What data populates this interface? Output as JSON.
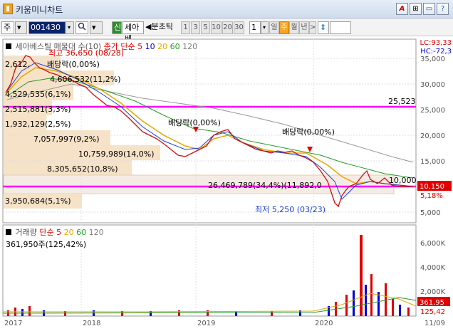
{
  "window": {
    "title": "키움미니차트",
    "app_icon": "chart-app-icon"
  },
  "titlebar_buttons": [
    "A",
    "⊞",
    "▭",
    "?",
    "✕"
  ],
  "toolbar": {
    "market": "주",
    "code": "001430",
    "search_icon": "search-icon",
    "new_badge": "신",
    "stock_name": "세아베",
    "split_label": "◀분초틱",
    "periods": [
      "1",
      "3",
      "5",
      "10",
      "20",
      "30"
    ],
    "period_value": "1",
    "unit_day": "일",
    "unit_week": "주",
    "unit_month": "월",
    "unit_year": "년",
    "arrow_right": ">",
    "updown_icon": "updown-icon"
  },
  "upper_legend": {
    "name": "세아베스틸 매물대 수(10)",
    "ma_label": "종가 단순",
    "ma_values": [
      "5",
      "10",
      "20",
      "60",
      "120"
    ],
    "colors": {
      "ma5": "#ff0000",
      "ma10": "#0000ff",
      "ma20": "#e6a800",
      "ma60": "#008000",
      "ma120": "#808080"
    }
  },
  "upper_corner": {
    "lc": "LC:93,33",
    "hc": "HC:-72,3"
  },
  "y_axis_upper": [
    "35,000",
    "30,000",
    "25,000",
    "20,000",
    "15,000",
    "10,000",
    "5,000"
  ],
  "volume_profile": [
    {
      "label": "2,612,",
      "extra": "배당락(0,00%)"
    },
    {
      "label": "4,606,532(11,2%)"
    },
    {
      "label": "4,529,535(6,1%)"
    },
    {
      "label": "2,515,881(3,3%)"
    },
    {
      "label": "1,932,129(2,5%)"
    },
    {
      "label": "7,057,997(9,2%)"
    },
    {
      "label": "10,759,989(14,0%)"
    },
    {
      "label": "8,305,652(10,8%)"
    },
    {
      "label": "26,469,789(34,4%)(11,892,0"
    },
    {
      "label": "3,950,684(5,1%)"
    }
  ],
  "annotations": {
    "high": "최고 36,650 (08/28)",
    "low": "최저 5,250 (03/23)",
    "div1": "배당락(0,00%)",
    "div2": "배당락(0,00%)",
    "line_25523": "25,523",
    "line_10000": "10,000",
    "price_current": "10,150",
    "pct_current": "5,18%"
  },
  "lower_legend": {
    "name": "거래량",
    "ma_label": "단순",
    "ma_values": [
      "5",
      "20",
      "60",
      "120"
    ],
    "current": "361,950주(125,42%)"
  },
  "y_axis_lower": [
    "6,000K",
    "4,000K",
    "2,000K"
  ],
  "lower_corner": {
    "value": "361,95",
    "pct": "125,42"
  },
  "x_axis": [
    "2017",
    "2018",
    "2019",
    "2020",
    "11/09"
  ]
}
